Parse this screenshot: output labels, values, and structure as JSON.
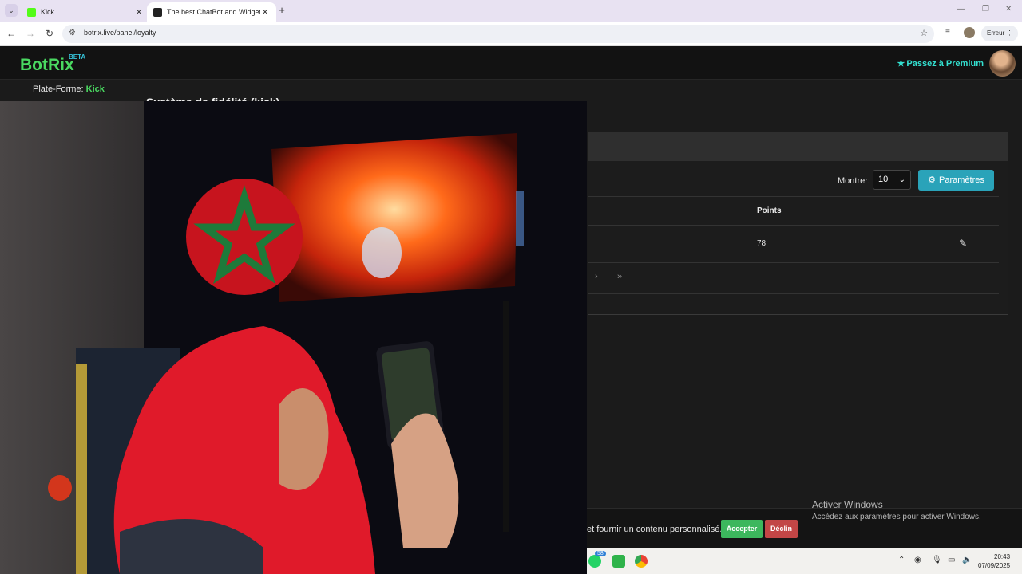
{
  "browser": {
    "tabs": [
      {
        "title": "Kick",
        "favicon_color": "#53fc18"
      },
      {
        "title": "The best ChatBot and Widgets",
        "favicon_color": "#222222"
      }
    ],
    "url": "botrix.live/panel/loyalty",
    "profile_button_label": "Erreur"
  },
  "site": {
    "logo": "BotRix",
    "beta": "BETA",
    "premium_label": "Passez à Premium",
    "platform_label": "Plate-Forme:",
    "platform_value": "Kick",
    "page_title": "Système de fidélité (kick)"
  },
  "loyalty_table": {
    "show_label": "Montrer:",
    "show_value": "10",
    "params_button": "Paramètres",
    "column_points": "Points",
    "rows": [
      {
        "points": "78"
      }
    ]
  },
  "cookie_bar": {
    "text": "et fournir un contenu personnalisé.",
    "accept": "Accepter",
    "decline": "Déclin"
  },
  "windows_watermark": {
    "title": "Activer Windows",
    "subtitle": "Accédez aux paramètres pour activer Windows."
  },
  "taskbar": {
    "whatsapp_badge": "58",
    "time": "20:43",
    "date": "07/09/2025"
  },
  "colors": {
    "accent_green": "#4ad861",
    "premium_cyan": "#33e0d0",
    "params_button": "#2aa3b9",
    "accept_green": "#3cb75d",
    "decline_red": "#c24646"
  }
}
